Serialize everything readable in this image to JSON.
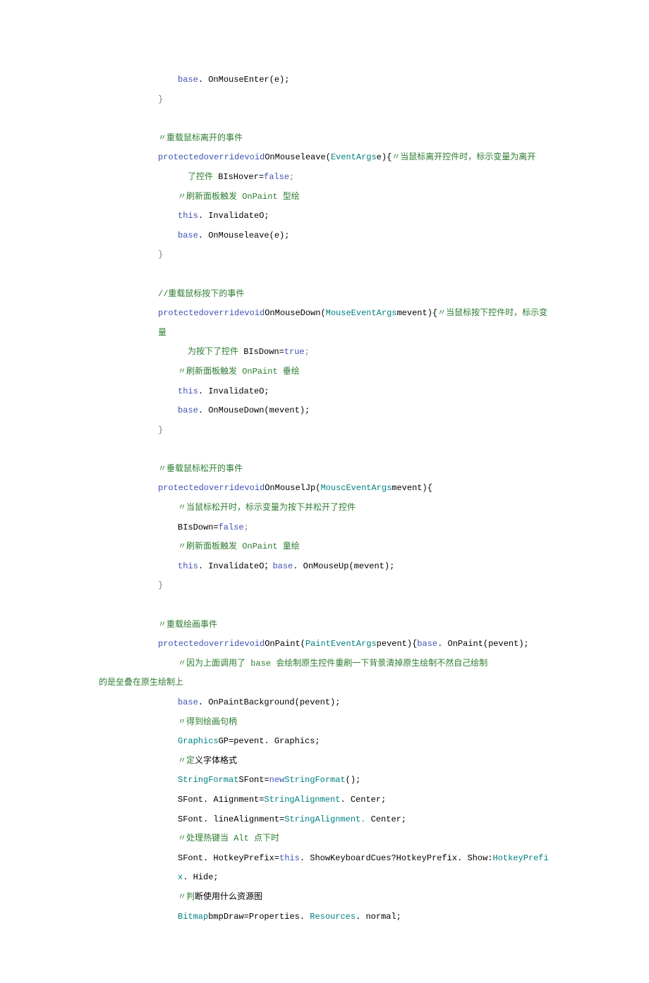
{
  "lines": [
    [
      {
        "cls": "line",
        "indent": 16,
        "parts": [
          {
            "cls": "blue",
            "t": "base"
          },
          {
            "cls": "black",
            "t": ". OnMouseEnter(e);"
          }
        ]
      }
    ],
    [
      {
        "cls": "line",
        "indent": 12,
        "parts": [
          {
            "cls": "gray",
            "t": "}"
          }
        ]
      }
    ],
    [
      {
        "cls": "line",
        "indent": 0,
        "parts": [
          {
            "cls": "black",
            "t": ""
          }
        ]
      }
    ],
    [
      {
        "cls": "line",
        "indent": 12,
        "parts": [
          {
            "cls": "green",
            "t": "〃重载鼠标离开的事件"
          }
        ]
      }
    ],
    [
      {
        "cls": "line",
        "indent": 12,
        "parts": [
          {
            "cls": "blue",
            "t": "protectedoverridevoid"
          },
          {
            "cls": "black",
            "t": "OnMouseleave("
          },
          {
            "cls": "teal",
            "t": "EventArgs"
          },
          {
            "cls": "black",
            "t": "e){"
          },
          {
            "cls": "green",
            "t": "〃当鼠标离开控件时，标示变量为离开"
          }
        ]
      }
    ],
    [
      {
        "cls": "line",
        "indent": 18,
        "parts": [
          {
            "cls": "green",
            "t": "了控件 "
          },
          {
            "cls": "black",
            "t": "BIsHover="
          },
          {
            "cls": "blue",
            "t": "false"
          },
          {
            "cls": "gray",
            "t": ";"
          }
        ]
      }
    ],
    [
      {
        "cls": "line",
        "indent": 16,
        "parts": [
          {
            "cls": "green",
            "t": "〃刷新面板触发 OnPaint 型绘"
          }
        ]
      }
    ],
    [
      {
        "cls": "line",
        "indent": 16,
        "parts": [
          {
            "cls": "blue",
            "t": "this"
          },
          {
            "cls": "black",
            "t": ". InvalidateO;"
          }
        ]
      }
    ],
    [
      {
        "cls": "line",
        "indent": 16,
        "parts": [
          {
            "cls": "blue",
            "t": "base"
          },
          {
            "cls": "black",
            "t": ". OnMouseleave(e);"
          }
        ]
      }
    ],
    [
      {
        "cls": "line",
        "indent": 12,
        "parts": [
          {
            "cls": "gray",
            "t": "}"
          }
        ]
      }
    ],
    [
      {
        "cls": "line",
        "indent": 0,
        "parts": [
          {
            "cls": "black",
            "t": ""
          }
        ]
      }
    ],
    [
      {
        "cls": "line",
        "indent": 12,
        "parts": [
          {
            "cls": "green",
            "t": "//重载鼠标按下的事件"
          }
        ]
      }
    ],
    [
      {
        "cls": "line",
        "indent": 12,
        "parts": [
          {
            "cls": "blue",
            "t": "protectedoverridevoid"
          },
          {
            "cls": "black",
            "t": "OnMouseDown("
          },
          {
            "cls": "teal",
            "t": "MouseEventArgs"
          },
          {
            "cls": "black",
            "t": "mevent){"
          },
          {
            "cls": "green",
            "t": "〃当鼠标按下控件时，标示变量"
          }
        ]
      }
    ],
    [
      {
        "cls": "line",
        "indent": 18,
        "parts": [
          {
            "cls": "green",
            "t": "为按下了控件 "
          },
          {
            "cls": "black",
            "t": "BIsDown="
          },
          {
            "cls": "blue",
            "t": "true"
          },
          {
            "cls": "gray",
            "t": ";"
          }
        ]
      }
    ],
    [
      {
        "cls": "line",
        "indent": 16,
        "parts": [
          {
            "cls": "green",
            "t": "〃刷新面板触发 OnPaint 垂绘"
          }
        ]
      }
    ],
    [
      {
        "cls": "line",
        "indent": 16,
        "parts": [
          {
            "cls": "blue",
            "t": "this"
          },
          {
            "cls": "black",
            "t": ". InvalidateO;"
          }
        ]
      }
    ],
    [
      {
        "cls": "line",
        "indent": 16,
        "parts": [
          {
            "cls": "blue",
            "t": "base"
          },
          {
            "cls": "black",
            "t": ". OnMouseDown(mevent);"
          }
        ]
      }
    ],
    [
      {
        "cls": "line",
        "indent": 12,
        "parts": [
          {
            "cls": "gray",
            "t": "}"
          }
        ]
      }
    ],
    [
      {
        "cls": "line",
        "indent": 0,
        "parts": [
          {
            "cls": "black",
            "t": ""
          }
        ]
      }
    ],
    [
      {
        "cls": "line",
        "indent": 12,
        "parts": [
          {
            "cls": "green",
            "t": "〃垂载鼠标松开的事件"
          }
        ]
      }
    ],
    [
      {
        "cls": "line",
        "indent": 12,
        "parts": [
          {
            "cls": "blue",
            "t": "protectedoverridevoid"
          },
          {
            "cls": "black",
            "t": "OnMouselJp("
          },
          {
            "cls": "teal",
            "t": "MouscEventArgs"
          },
          {
            "cls": "black",
            "t": "mevent){"
          }
        ]
      }
    ],
    [
      {
        "cls": "line",
        "indent": 16,
        "parts": [
          {
            "cls": "green",
            "t": "〃当鼠标松开时，标示变量为按下并松开了控件"
          }
        ]
      }
    ],
    [
      {
        "cls": "line",
        "indent": 16,
        "parts": [
          {
            "cls": "black",
            "t": "BIsDown="
          },
          {
            "cls": "blue",
            "t": "false"
          },
          {
            "cls": "gray",
            "t": ";"
          }
        ]
      }
    ],
    [
      {
        "cls": "line",
        "indent": 16,
        "parts": [
          {
            "cls": "green",
            "t": "〃刷新面板触发 OnPaint 童绘"
          }
        ]
      }
    ],
    [
      {
        "cls": "line",
        "indent": 16,
        "parts": [
          {
            "cls": "blue",
            "t": "this"
          },
          {
            "cls": "black",
            "t": ". InvalidateO；"
          },
          {
            "cls": "blue",
            "t": "base"
          },
          {
            "cls": "black",
            "t": ". OnMouseUp(mevent);"
          }
        ]
      }
    ],
    [
      {
        "cls": "line",
        "indent": 12,
        "parts": [
          {
            "cls": "gray",
            "t": "}"
          }
        ]
      }
    ],
    [
      {
        "cls": "line",
        "indent": 0,
        "parts": [
          {
            "cls": "black",
            "t": ""
          }
        ]
      }
    ],
    [
      {
        "cls": "line",
        "indent": 12,
        "parts": [
          {
            "cls": "green",
            "t": "〃重载绘画事件"
          }
        ]
      }
    ],
    [
      {
        "cls": "line",
        "indent": 12,
        "parts": [
          {
            "cls": "blue",
            "t": "protectedoverridevoid"
          },
          {
            "cls": "black",
            "t": "OnPaint("
          },
          {
            "cls": "teal",
            "t": "PaintEventArgs"
          },
          {
            "cls": "black",
            "t": "pevent){"
          },
          {
            "cls": "blue",
            "t": "base"
          },
          {
            "cls": "black",
            "t": ". OnPaint(pevent);"
          }
        ]
      }
    ],
    [
      {
        "cls": "line",
        "indent": 16,
        "parts": [
          {
            "cls": "green",
            "t": "〃因为上面调用了 base 会绘制原生控件重刷一下背景清掉原生绘制不然自己绘制"
          }
        ]
      }
    ],
    [
      {
        "cls": "line",
        "indent": 0,
        "parts": [
          {
            "cls": "green",
            "t": "的是垒叠在原生绘制上"
          }
        ]
      }
    ],
    [
      {
        "cls": "line",
        "indent": 16,
        "parts": [
          {
            "cls": "blue",
            "t": "base"
          },
          {
            "cls": "black",
            "t": ". OnPaintBackground(pevent);"
          }
        ]
      }
    ],
    [
      {
        "cls": "line",
        "indent": 16,
        "parts": [
          {
            "cls": "green",
            "t": "〃得到绘画句柄"
          }
        ]
      }
    ],
    [
      {
        "cls": "line",
        "indent": 16,
        "parts": [
          {
            "cls": "teal",
            "t": "Graphics"
          },
          {
            "cls": "black",
            "t": "GP=pevent. Graphics;"
          }
        ]
      }
    ],
    [
      {
        "cls": "line",
        "indent": 16,
        "parts": [
          {
            "cls": "green",
            "t": "〃定"
          },
          {
            "cls": "black",
            "t": "义字体格式"
          }
        ]
      }
    ],
    [
      {
        "cls": "line",
        "indent": 16,
        "parts": [
          {
            "cls": "teal",
            "t": "StringFormat"
          },
          {
            "cls": "black",
            "t": "SFont="
          },
          {
            "cls": "blue",
            "t": "new"
          },
          {
            "cls": "teal",
            "t": "StringFormat"
          },
          {
            "cls": "black",
            "t": "();"
          }
        ]
      }
    ],
    [
      {
        "cls": "line",
        "indent": 16,
        "parts": [
          {
            "cls": "black",
            "t": "SFont. A1ignment="
          },
          {
            "cls": "teal",
            "t": "StringAlignment"
          },
          {
            "cls": "black",
            "t": ". Center;"
          }
        ]
      }
    ],
    [
      {
        "cls": "line",
        "indent": 16,
        "parts": [
          {
            "cls": "black",
            "t": "SFont. lineAlignment="
          },
          {
            "cls": "teal",
            "t": "StringAlignment."
          },
          {
            "cls": "black",
            "t": " Center;"
          }
        ]
      }
    ],
    [
      {
        "cls": "line",
        "indent": 16,
        "parts": [
          {
            "cls": "green",
            "t": "〃处理热键当 Alt 点下时"
          }
        ]
      }
    ],
    [
      {
        "cls": "line",
        "indent": 16,
        "parts": [
          {
            "cls": "black",
            "t": "SFont. HotkeyPrefix="
          },
          {
            "cls": "blue",
            "t": "this"
          },
          {
            "cls": "black",
            "t": ". ShowKeyboardCues?HotkeyPrefix. Show:"
          },
          {
            "cls": "teal",
            "t": "HotkeyPrefix"
          },
          {
            "cls": "black",
            "t": ". Hide;"
          }
        ]
      }
    ],
    [
      {
        "cls": "line",
        "indent": 16,
        "parts": [
          {
            "cls": "green",
            "t": "〃判"
          },
          {
            "cls": "black",
            "t": "断使用什么资源图"
          }
        ]
      }
    ],
    [
      {
        "cls": "line",
        "indent": 16,
        "parts": [
          {
            "cls": "teal",
            "t": "Bitmap"
          },
          {
            "cls": "black",
            "t": "bmpDraw=Properties. "
          },
          {
            "cls": "teal",
            "t": "Resources"
          },
          {
            "cls": "black",
            "t": ". normal;"
          }
        ]
      }
    ]
  ]
}
